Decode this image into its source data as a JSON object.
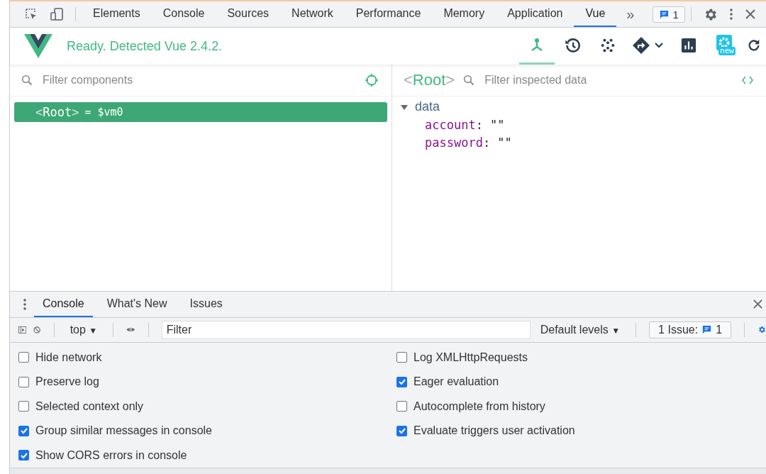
{
  "devtools_tabs": [
    {
      "label": "Elements",
      "selected": false
    },
    {
      "label": "Console",
      "selected": false
    },
    {
      "label": "Sources",
      "selected": false
    },
    {
      "label": "Network",
      "selected": false
    },
    {
      "label": "Performance",
      "selected": false
    },
    {
      "label": "Memory",
      "selected": false
    },
    {
      "label": "Application",
      "selected": false
    },
    {
      "label": "Vue",
      "selected": true
    }
  ],
  "more_tabs": "»",
  "issues_badge": "1",
  "vue_header": {
    "status": "Ready. Detected Vue 2.4.2.",
    "new_badge": "new",
    "tools": [
      {
        "kind": "components",
        "selected": true
      },
      {
        "kind": "history",
        "selected": false
      },
      {
        "kind": "dots",
        "selected": false
      },
      {
        "kind": "routing",
        "selected": false
      },
      {
        "kind": "chart",
        "selected": false
      },
      {
        "kind": "settings",
        "selected": false
      },
      {
        "kind": "refresh",
        "selected": false
      }
    ]
  },
  "components_panel": {
    "placeholder": "Filter components",
    "tree": [
      {
        "open": "<",
        "name": "Root",
        "close": ">",
        "ref": "= $vm0",
        "selected": true
      }
    ]
  },
  "inspector": {
    "open": "<",
    "name": "Root",
    "close": ">",
    "placeholder": "Filter inspected data",
    "separator": ":",
    "sections": [
      {
        "title": "data",
        "expanded": true,
        "props": [
          {
            "key": "account",
            "value": "\"\""
          },
          {
            "key": "password",
            "value": "\"\""
          }
        ]
      }
    ]
  },
  "drawer": {
    "tabs": [
      {
        "label": "Console",
        "selected": true
      },
      {
        "label": "What's New",
        "selected": false
      },
      {
        "label": "Issues",
        "selected": false
      }
    ],
    "context": "top",
    "context_caret": "▼",
    "filter_placeholder": "Filter",
    "levels": "Default levels",
    "levels_caret": "▼",
    "issues_label": "1 Issue:",
    "issues_count": "1",
    "settings": [
      [
        {
          "label": "Hide network",
          "checked": false
        },
        {
          "label": "Preserve log",
          "checked": false
        },
        {
          "label": "Selected context only",
          "checked": false
        },
        {
          "label": "Group similar messages in console",
          "checked": true
        },
        {
          "label": "Show CORS errors in console",
          "checked": true
        }
      ],
      [
        {
          "label": "Log XMLHttpRequests",
          "checked": false
        },
        {
          "label": "Eager evaluation",
          "checked": true
        },
        {
          "label": "Autocomplete from history",
          "checked": false
        },
        {
          "label": "Evaluate triggers user activation",
          "checked": true
        }
      ]
    ]
  }
}
